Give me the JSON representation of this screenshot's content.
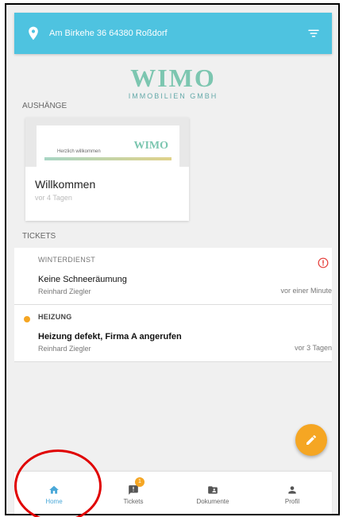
{
  "header": {
    "address": "Am Birkehe 36 64380 Roßdorf"
  },
  "logo": {
    "word": "WIMO",
    "sub": "IMMOBILIEN GMBH"
  },
  "sections": {
    "notices": "AUSHÄNGE",
    "tickets": "TICKETS"
  },
  "notice_card": {
    "title": "Willkommen",
    "age": "vor 4 Tagen",
    "image_logo": "WIMO",
    "image_text": "Herzlich willkommen"
  },
  "tickets": [
    {
      "category": "WINTERDIENST",
      "title": "Keine Schneeräumung",
      "author": "Reinhard Ziegler",
      "time": "vor einer Minute"
    },
    {
      "category": "HEIZUNG",
      "title": "Heizung defekt, Firma A angerufen",
      "author": "Reinhard Ziegler",
      "time": "vor 3 Tagen"
    }
  ],
  "nav": {
    "home": "Home",
    "tickets": "Tickets",
    "tickets_badge": "1",
    "documents": "Dokumente",
    "profile": "Profil"
  },
  "colors": {
    "primary": "#4ec3e0",
    "accent": "#f5a623",
    "alert": "#e53935",
    "active_nav": "#4aa8d8"
  }
}
